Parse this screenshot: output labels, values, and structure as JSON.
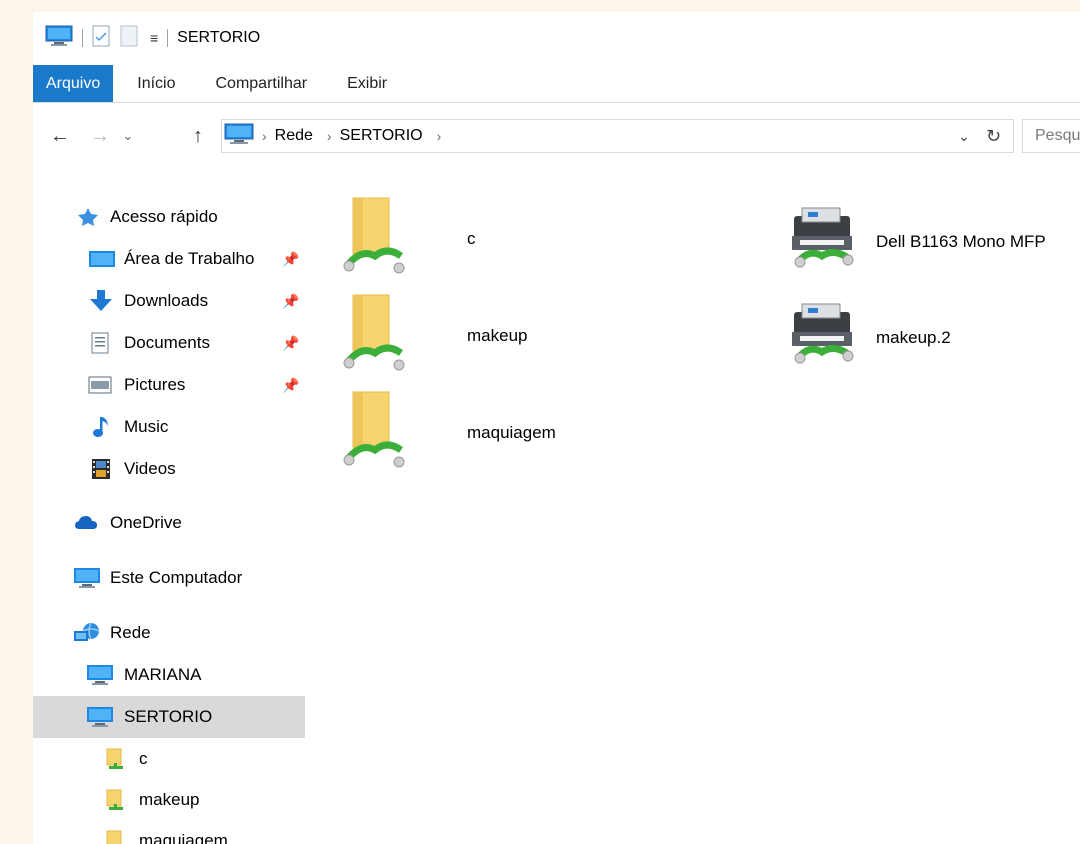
{
  "title": "SERTORIO",
  "ribbon": {
    "tabs": [
      "Arquivo",
      "Início",
      "Compartilhar",
      "Exibir"
    ]
  },
  "address": {
    "crumbs": [
      "Rede",
      "SERTORIO"
    ],
    "search_placeholder": "Pesquisar SERTORIO"
  },
  "sidebar": {
    "quick_access": "Acesso rápido",
    "desktop": "Área de Trabalho",
    "downloads": "Downloads",
    "documents": "Documents",
    "pictures": "Pictures",
    "music": "Music",
    "videos": "Videos",
    "onedrive": "OneDrive",
    "this_pc": "Este Computador",
    "network": "Rede",
    "mariana": "MARIANA",
    "sertorio": "SERTORIO",
    "share_c": "c",
    "share_makeup": "makeup",
    "share_maquiagem": "maquiagem"
  },
  "content": {
    "shares": [
      "c",
      "makeup",
      "maquiagem"
    ],
    "printers": [
      "Dell B1163 Mono MFP",
      "makeup.2"
    ]
  },
  "colors": {
    "file_tab": "#1979ca",
    "selection": "#d9d9d9",
    "folder": "#f6d56e",
    "network_green": "#3cae3a"
  }
}
